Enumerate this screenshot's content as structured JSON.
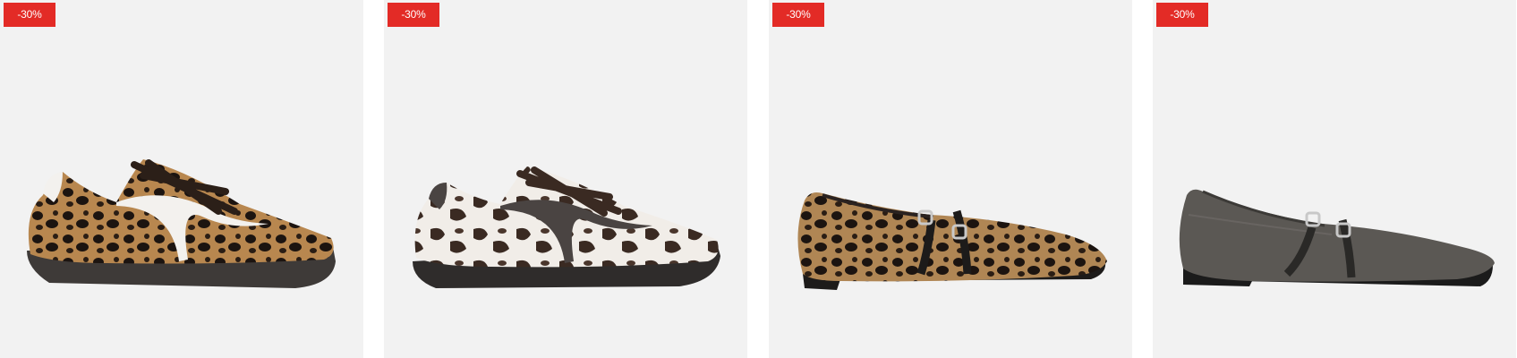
{
  "products": [
    {
      "badge": "-30%",
      "image_icon": "leopard-sneaker-icon"
    },
    {
      "badge": "-30%",
      "image_icon": "cow-print-sneaker-icon"
    },
    {
      "badge": "-30%",
      "image_icon": "leopard-mary-jane-flat-icon"
    },
    {
      "badge": "-30%",
      "image_icon": "grey-mary-jane-flat-icon"
    }
  ],
  "colors": {
    "badge_bg": "#e32b26",
    "card_bg": "#f2f2f2"
  }
}
